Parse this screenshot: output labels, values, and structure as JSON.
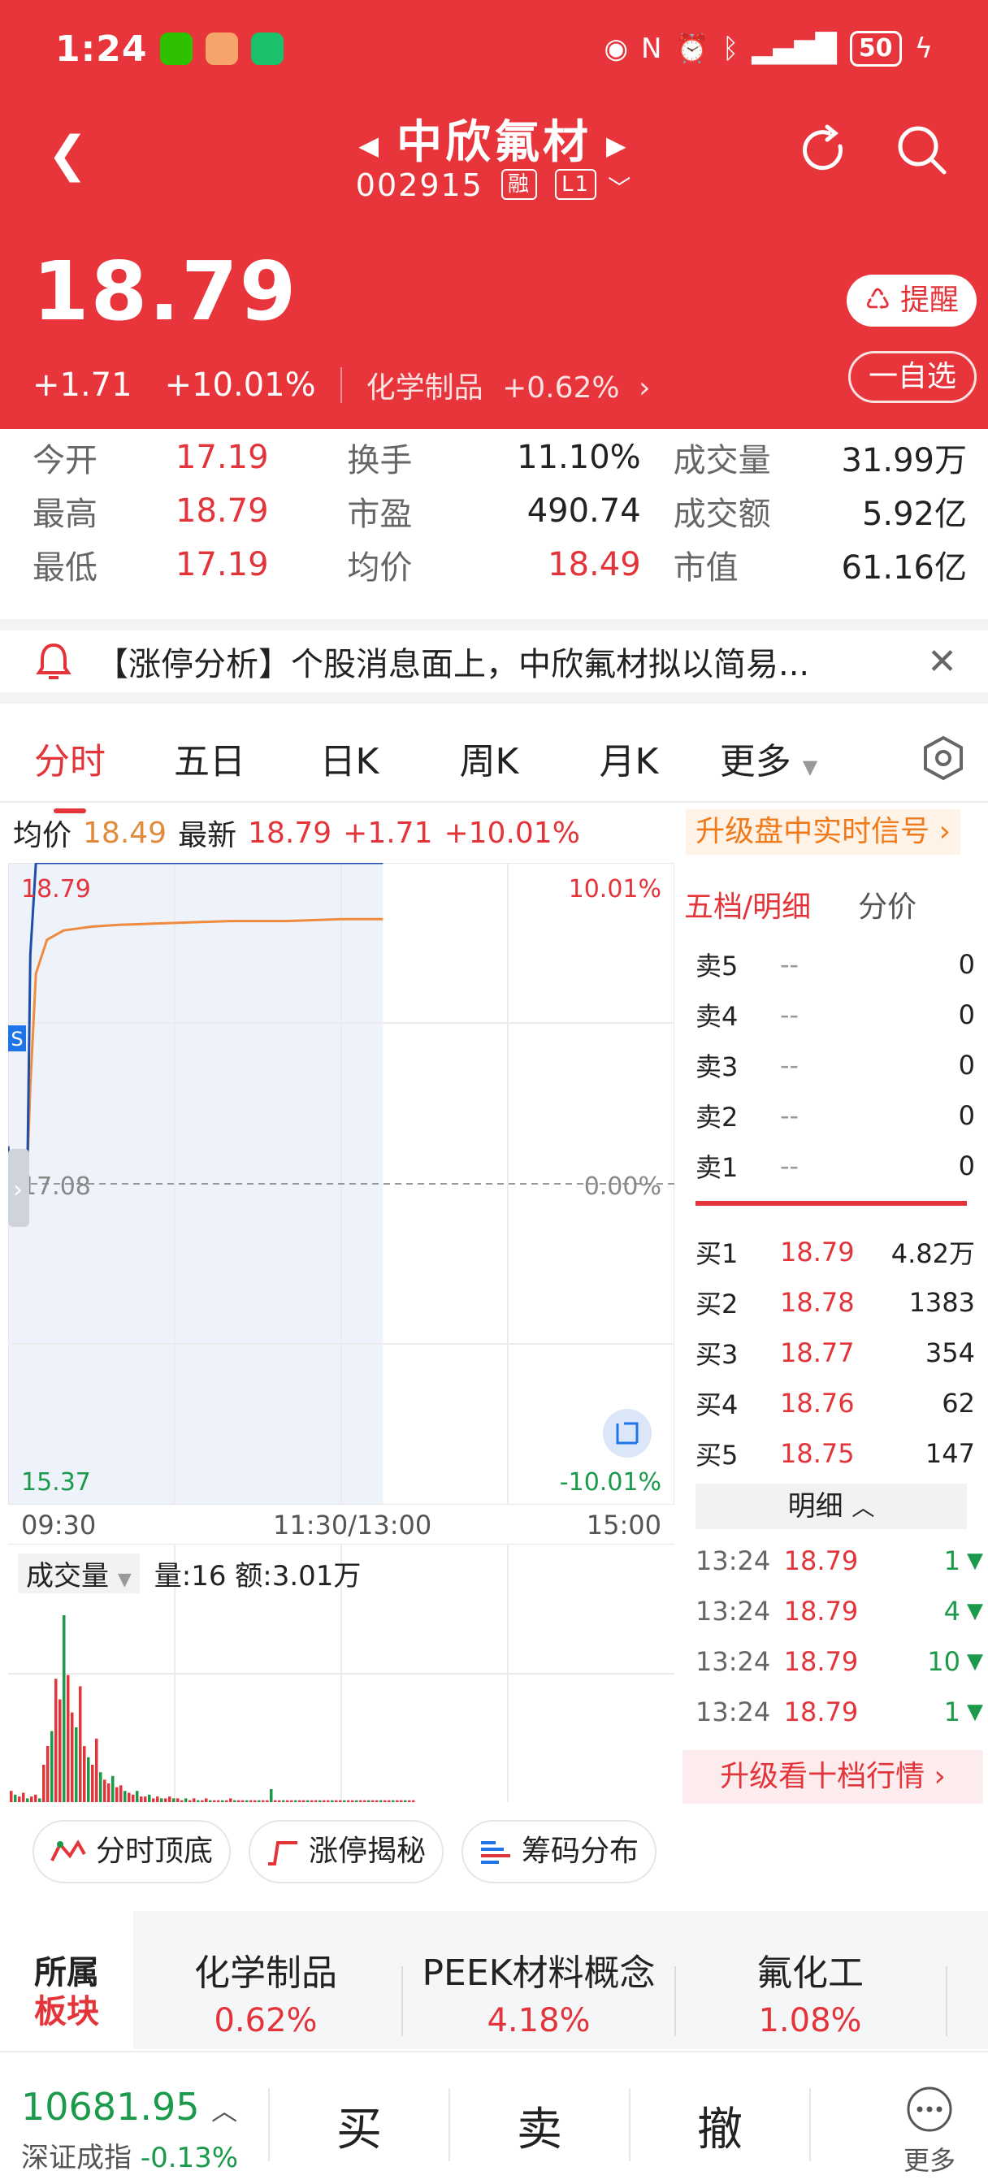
{
  "status": {
    "time": "1:24",
    "battery": "50"
  },
  "header": {
    "name": "中欣氟材",
    "code": "002915",
    "tag_margin": "融",
    "tag_level": "L1",
    "price": "18.79",
    "change": "+1.71",
    "change_pct": "+10.01%",
    "sector_name": "化学制品",
    "sector_pct": "+0.62%",
    "alert_label": "提醒",
    "watch_label": "一自选"
  },
  "stats": [
    [
      {
        "l": "今开",
        "v": "17.19"
      },
      {
        "l": "换手",
        "v": "11.10%"
      },
      {
        "l": "成交量",
        "v": "31.99万"
      }
    ],
    [
      {
        "l": "最高",
        "v": "18.79"
      },
      {
        "l": "市盈",
        "v": "490.74"
      },
      {
        "l": "成交额",
        "v": "5.92亿"
      }
    ],
    [
      {
        "l": "最低",
        "v": "17.19"
      },
      {
        "l": "均价",
        "v": "18.49"
      },
      {
        "l": "市值",
        "v": "61.16亿"
      }
    ]
  ],
  "news": {
    "text": "【涨停分析】个股消息面上，中欣氟材拟以简易..."
  },
  "tabs": [
    "分时",
    "五日",
    "日K",
    "周K",
    "月K",
    "更多"
  ],
  "infobar": {
    "avg_label": "均价",
    "avg_val": "18.49",
    "new_label": "最新",
    "new_val": "18.79",
    "chg": "+1.71",
    "pct": "+10.01%",
    "upgrade": "升级盘中实时信号 ›"
  },
  "chart": {
    "high_label": "18.79",
    "high_pct": "10.01%",
    "mid_label": "17.08",
    "mid_pct": "0.00%",
    "low_label": "15.37",
    "low_pct": "-10.01%",
    "s_marker": "S",
    "time_start": "09:30",
    "time_mid": "11:30/13:00",
    "time_end": "15:00"
  },
  "chart_data": {
    "type": "line",
    "ylim": [
      15.37,
      18.79
    ],
    "x": [
      0,
      1,
      2,
      3,
      4,
      5,
      6,
      7,
      8,
      10,
      14,
      20,
      30,
      40,
      60,
      80,
      100,
      120,
      135
    ],
    "series": [
      {
        "values": [
          17.28,
          17.13,
          17.16,
          17.1,
          17.15,
          17.12,
          17.18,
          17.2,
          18.3,
          18.79,
          18.79,
          18.79,
          18.79,
          18.79,
          18.79,
          18.79,
          18.79,
          18.79,
          18.79
        ]
      },
      {
        "values": [
          17.25,
          17.2,
          17.18,
          17.17,
          17.17,
          17.17,
          17.18,
          17.19,
          17.6,
          18.2,
          18.38,
          18.43,
          18.45,
          18.46,
          18.47,
          18.48,
          18.48,
          18.49,
          18.49
        ]
      }
    ],
    "volume": [
      6,
      4,
      3,
      5,
      2,
      3,
      4,
      2,
      20,
      30,
      38,
      66,
      55,
      100,
      68,
      48,
      40,
      62,
      30,
      24,
      20,
      34,
      16,
      12,
      10,
      14,
      8,
      9,
      6,
      5,
      4,
      6,
      3,
      3,
      4,
      2,
      3,
      2,
      2,
      3,
      2,
      2,
      1,
      2,
      1,
      2,
      1,
      1,
      2,
      1,
      1,
      1,
      1,
      1,
      2,
      1,
      1,
      1,
      1,
      1,
      1,
      1,
      1,
      1,
      7,
      1,
      1,
      1,
      1,
      1,
      1,
      1,
      1,
      1,
      1,
      1,
      1,
      1,
      1,
      1,
      1,
      1,
      1,
      1,
      1,
      1,
      1,
      1,
      1,
      1,
      1,
      1,
      1,
      1,
      1,
      1,
      1,
      1,
      1,
      1
    ]
  },
  "volume": {
    "label": "成交量",
    "info": "量:16 额:3.01万"
  },
  "book": {
    "tab1": "五档/明细",
    "tab2": "分价",
    "sells": [
      {
        "n": "卖5",
        "p": "--",
        "q": "0"
      },
      {
        "n": "卖4",
        "p": "--",
        "q": "0"
      },
      {
        "n": "卖3",
        "p": "--",
        "q": "0"
      },
      {
        "n": "卖2",
        "p": "--",
        "q": "0"
      },
      {
        "n": "卖1",
        "p": "--",
        "q": "0"
      }
    ],
    "buys": [
      {
        "n": "买1",
        "p": "18.79",
        "q": "4.82万"
      },
      {
        "n": "买2",
        "p": "18.78",
        "q": "1383"
      },
      {
        "n": "买3",
        "p": "18.77",
        "q": "354"
      },
      {
        "n": "买4",
        "p": "18.76",
        "q": "62"
      },
      {
        "n": "买5",
        "p": "18.75",
        "q": "147"
      }
    ],
    "detail_label": "明细",
    "ticks": [
      {
        "t": "13:24",
        "p": "18.79",
        "q": "1"
      },
      {
        "t": "13:24",
        "p": "18.79",
        "q": "4"
      },
      {
        "t": "13:24",
        "p": "18.79",
        "q": "10"
      },
      {
        "t": "13:24",
        "p": "18.79",
        "q": "1"
      }
    ],
    "upgrade10": "升级看十档行情 ›"
  },
  "features": [
    "分时顶底",
    "涨停揭秘",
    "筹码分布"
  ],
  "sectors": {
    "label_line1": "所属",
    "label_line2": "板块",
    "items": [
      {
        "name": "化学制品",
        "pct": "0.62%"
      },
      {
        "name": "PEEK材料概念",
        "pct": "4.18%"
      },
      {
        "name": "氟化工",
        "pct": "1.08%"
      }
    ]
  },
  "bottom": {
    "index_val": "10681.95",
    "index_name": "深证成指",
    "index_pct": "-0.13%",
    "buy": "买",
    "sell": "卖",
    "cancel": "撤",
    "more": "更多"
  },
  "colors": {
    "up": "#e3343a",
    "down": "#1a9a4a",
    "price_line": "#1f4ea8",
    "avg_line": "#f08a3c"
  }
}
